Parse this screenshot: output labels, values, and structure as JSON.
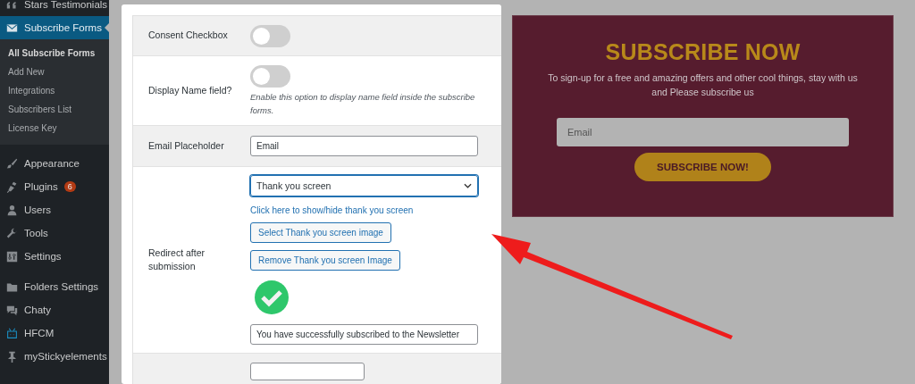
{
  "sidebar": {
    "items": [
      {
        "label": "Stars Testimonials",
        "selected": false
      },
      {
        "label": "Subscribe Forms",
        "selected": true,
        "submenu": [
          {
            "label": "All Subscribe Forms",
            "selected": true
          },
          {
            "label": "Add New",
            "selected": false
          },
          {
            "label": "Integrations",
            "selected": false
          },
          {
            "label": "Subscribers List",
            "selected": false
          },
          {
            "label": "License Key",
            "selected": false
          }
        ]
      },
      {
        "label": "Appearance",
        "selected": false,
        "group_start": true
      },
      {
        "label": "Plugins",
        "selected": false,
        "badge": "6"
      },
      {
        "label": "Users",
        "selected": false
      },
      {
        "label": "Tools",
        "selected": false
      },
      {
        "label": "Settings",
        "selected": false
      },
      {
        "label": "Folders Settings",
        "selected": false,
        "group_start": true
      },
      {
        "label": "Chaty",
        "selected": false
      },
      {
        "label": "HFCM",
        "selected": false
      },
      {
        "label": "myStickyelements",
        "selected": false
      }
    ]
  },
  "settings": {
    "rows": [
      {
        "kind": "toggle",
        "label": "Consent Checkbox",
        "on": false
      },
      {
        "kind": "toggle",
        "label": "Display Name field?",
        "on": false,
        "help": "Enable this option to display name field inside the subscribe forms."
      },
      {
        "kind": "text",
        "label": "Email Placeholder",
        "value": "Email"
      },
      {
        "kind": "redirect",
        "label": "Redirect after submission",
        "select": "Thank you screen",
        "link": "Click here to show/hide thank you screen",
        "buttons": [
          "Select Thank you screen image",
          "Remove Thank you screen Image"
        ],
        "message": "You have successfully subscribed to the Newsletter"
      },
      {
        "kind": "partial"
      }
    ]
  },
  "preview": {
    "title": "SUBSCRIBE NOW",
    "text": "To sign-up for a free and amazing offers and other cool things, stay with us and Please subscribe us",
    "email_placeholder": "Email",
    "button": "SUBSCRIBE NOW!"
  }
}
